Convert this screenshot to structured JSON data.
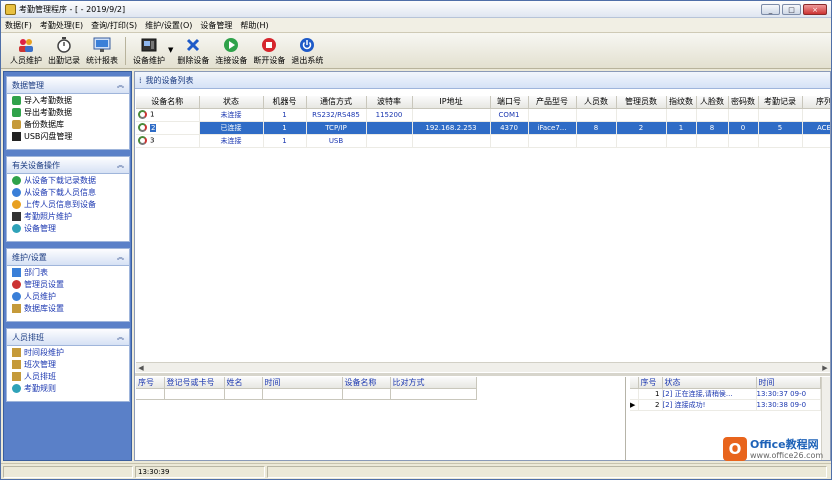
{
  "window": {
    "title": "考勤管理程序 - [ - 2019/9/2]",
    "controls": [
      "_",
      "□",
      "×"
    ]
  },
  "menu": [
    "数据(F)",
    "考勤处理(E)",
    "查询/打印(S)",
    "维护/设置(O)",
    "设备管理",
    "帮助(H)"
  ],
  "toolbar": [
    {
      "label": "人员维护",
      "icon": "users-icon"
    },
    {
      "label": "出勤记录",
      "icon": "stopwatch-icon"
    },
    {
      "label": "统计报表",
      "icon": "monitor-icon"
    },
    {
      "label": "设备维护",
      "icon": "device-icon"
    },
    {
      "label": "删除设备",
      "icon": "delete-x-icon"
    },
    {
      "label": "连接设备",
      "icon": "play-green-icon"
    },
    {
      "label": "断开设备",
      "icon": "stop-red-icon"
    },
    {
      "label": "退出系统",
      "icon": "power-icon"
    }
  ],
  "sidebar": [
    {
      "title": "数据管理",
      "items": [
        "导入考勤数据",
        "导出考勤数据",
        "备份数据库",
        "USB闪盘管理"
      ]
    },
    {
      "title": "有关设备操作",
      "items": [
        "从设备下载记录数据",
        "从设备下载人员信息",
        "上传人员信息到设备",
        "考勤照片维护",
        "设备管理"
      ]
    },
    {
      "title": "维护/设置",
      "items": [
        "部门表",
        "管理员设置",
        "人员维护",
        "数据库设置"
      ]
    },
    {
      "title": "人员排班",
      "items": [
        "时间段维护",
        "班次管理",
        "人员排班",
        "考勤规则"
      ]
    }
  ],
  "device_list": {
    "header": "我的设备列表",
    "columns": [
      "设备名称",
      "状态",
      "机器号",
      "通信方式",
      "波特率",
      "IP地址",
      "端口号",
      "产品型号",
      "人员数",
      "管理员数",
      "指纹数",
      "人脸数",
      "密码数",
      "考勤记录",
      "序列"
    ],
    "rows": [
      [
        "1",
        "未连接",
        "1",
        "RS232/RS485",
        "115200",
        "",
        "COM1",
        "",
        "",
        "",
        "",
        "",
        "",
        "",
        ""
      ],
      [
        "2",
        "已连接",
        "1",
        "TCP/IP",
        "",
        "192.168.2.253",
        "4370",
        "iFace7...",
        "8",
        "2",
        "1",
        "8",
        "0",
        "5",
        "ACE"
      ],
      [
        "3",
        "未连接",
        "1",
        "USB",
        "",
        "",
        "",
        "",
        "",
        "",
        "",
        "",
        "",
        "",
        ""
      ]
    ],
    "selected_row": 1
  },
  "record_table": {
    "columns": [
      "序号",
      "登记号或卡号",
      "姓名",
      "时间",
      "设备名称",
      "比对方式"
    ]
  },
  "log_table": {
    "columns": [
      "序号",
      "状态",
      "时间"
    ],
    "rows": [
      {
        "num": "1",
        "status": "[2] 正在连接,请稍侯...",
        "time": "13:30:37 09-0"
      },
      {
        "num": "2",
        "status": "[2] 连接成功!",
        "time": "13:30:38 09-0"
      }
    ]
  },
  "statusbar": {
    "panels": [
      "",
      "13:30:39",
      ""
    ]
  },
  "watermark": {
    "logo": "O",
    "main": "Office教程网",
    "sub": "www.office26.com"
  }
}
